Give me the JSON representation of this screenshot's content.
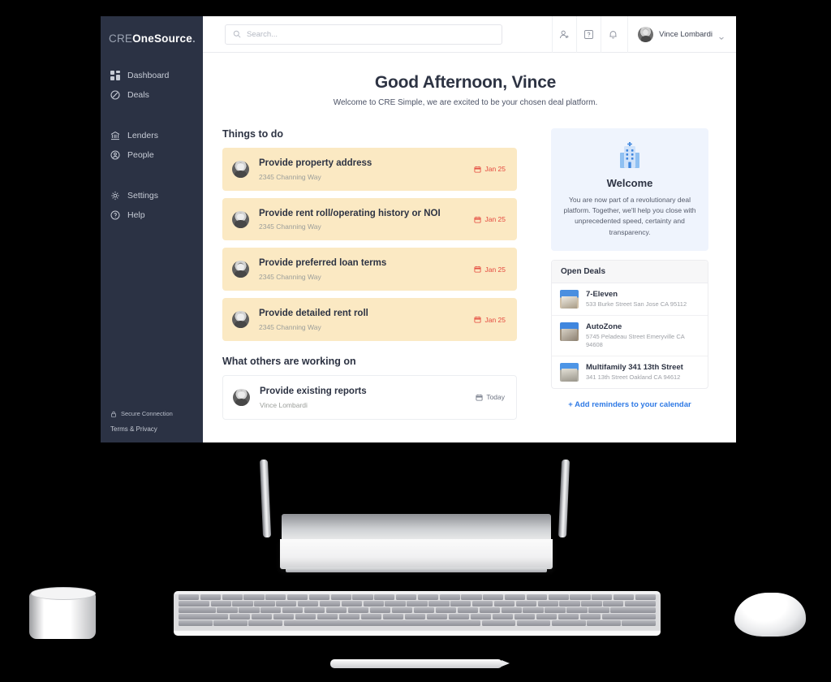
{
  "app": {
    "logo": {
      "part1": "CRE",
      "part2": "OneSource",
      "part3": "."
    }
  },
  "sidebar": {
    "groups": [
      {
        "items": [
          {
            "label": "Dashboard",
            "icon": "dashboard-grid-icon"
          },
          {
            "label": "Deals",
            "icon": "deals-tag-icon"
          }
        ]
      },
      {
        "items": [
          {
            "label": "Lenders",
            "icon": "bank-building-icon"
          },
          {
            "label": "People",
            "icon": "person-circle-icon"
          }
        ]
      },
      {
        "items": [
          {
            "label": "Settings",
            "icon": "gear-icon"
          },
          {
            "label": "Help",
            "icon": "help-circle-icon"
          }
        ]
      }
    ],
    "footer": {
      "secure_label": "Secure Connection",
      "secure_icon": "lock-icon",
      "terms_label": "Terms & Privacy"
    }
  },
  "topbar": {
    "search": {
      "placeholder": "Search...",
      "value": "",
      "icon": "search-icon"
    },
    "icons": [
      {
        "name": "add-user-icon"
      },
      {
        "name": "help-square-icon"
      },
      {
        "name": "bell-icon"
      }
    ],
    "user": {
      "name": "Vince Lombardi",
      "avatar": "user-avatar",
      "chevron": "chevron-down-icon"
    }
  },
  "main": {
    "greeting": "Good Afternoon, Vince",
    "subtitle": "Welcome to CRE Simple, we are excited to be your chosen deal platform.",
    "things_to_do_title": "Things to do",
    "things_to_do": [
      {
        "title": "Provide property address",
        "subtitle": "2345 Channing Way",
        "due": "Jan 25",
        "due_icon": "calendar-icon"
      },
      {
        "title": "Provide rent roll/operating history or NOI",
        "subtitle": "2345 Channing Way",
        "due": "Jan 25",
        "due_icon": "calendar-icon"
      },
      {
        "title": "Provide preferred loan terms",
        "subtitle": "2345 Channing Way",
        "due": "Jan 25",
        "due_icon": "calendar-icon"
      },
      {
        "title": "Provide detailed rent roll",
        "subtitle": "2345 Channing Way",
        "due": "Jan 25",
        "due_icon": "calendar-icon"
      }
    ],
    "others_title": "What others are working on",
    "others": [
      {
        "title": "Provide existing reports",
        "subtitle": "Vince Lombardi",
        "due": "Today",
        "due_icon": "calendar-icon"
      }
    ]
  },
  "panel": {
    "welcome": {
      "icon": "office-building-icon",
      "title": "Welcome",
      "text": "You are now part of a revolutionary deal platform. Together, we'll help you close with unprecedented speed, certainty and transparency."
    },
    "open_deals": {
      "title": "Open Deals",
      "items": [
        {
          "name": "7-Eleven",
          "address": "533 Burke Street San Jose CA 95112",
          "thumb": "property-photo"
        },
        {
          "name": "AutoZone",
          "address": "5745 Peladeau Street Emeryville CA 94608",
          "thumb": "property-photo"
        },
        {
          "name": "Multifamily 341 13th Street",
          "address": "341 13th Street Oakland CA 94612",
          "thumb": "property-photo"
        }
      ]
    },
    "add_reminders": "+ Add reminders to your calendar"
  },
  "colors": {
    "sidebar_bg": "#2b3244",
    "task_bg": "#fbe9c3",
    "due_red": "#e4483d",
    "link_blue": "#2f7ae5",
    "welcome_bg": "#eff4fd"
  }
}
